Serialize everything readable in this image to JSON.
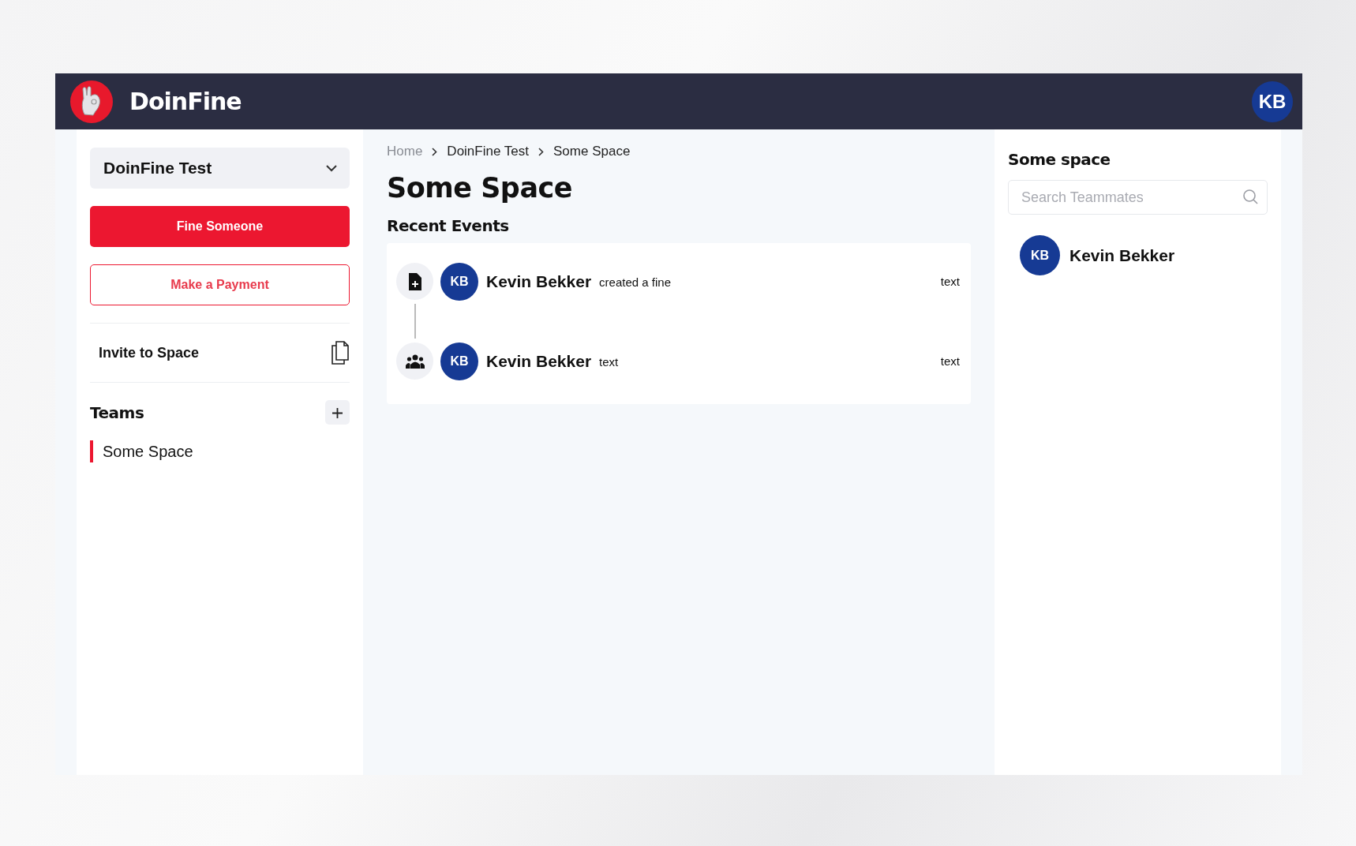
{
  "header": {
    "brand": "DoinFine",
    "avatar": "KB"
  },
  "sidebar": {
    "space_selector": "DoinFine Test",
    "buttons": [
      {
        "label": "Fine Someone",
        "kind": "primary"
      },
      {
        "label": "Make a Payment",
        "kind": "outline"
      }
    ],
    "invite": "Invite to Space",
    "teams_heading": "Teams",
    "teams": [
      {
        "label": "Some Space",
        "selected": true
      }
    ]
  },
  "breadcrumb": [
    "Home",
    "DoinFine Test",
    "Some Space"
  ],
  "title": "Some Space",
  "section": "Recent Events",
  "events": [
    {
      "kind": "fine",
      "initials": "KB",
      "name": "Kevin Bekker",
      "action": "created a fine",
      "time": "text"
    },
    {
      "kind": "team",
      "initials": "KB",
      "name": "Kevin Bekker",
      "action": "text",
      "time": "text"
    }
  ],
  "right_panel": {
    "title": "Some space",
    "search": {
      "placeholder": "Search Teammates"
    },
    "members": [
      {
        "initials": "KB",
        "name": "Kevin Bekker"
      }
    ]
  }
}
